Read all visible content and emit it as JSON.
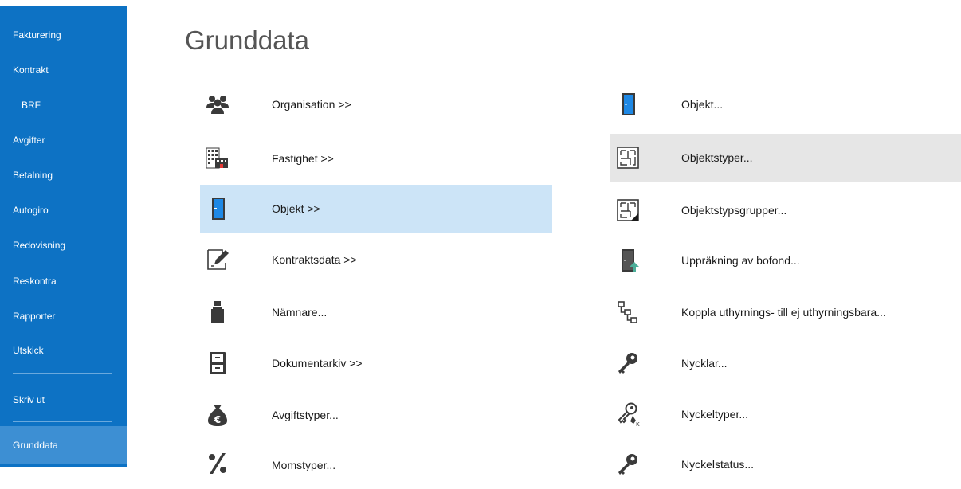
{
  "sidebar": {
    "items": [
      {
        "label": "Fakturering"
      },
      {
        "label": "Kontrakt"
      },
      {
        "label": "BRF"
      },
      {
        "label": "Avgifter"
      },
      {
        "label": "Betalning"
      },
      {
        "label": "Autogiro"
      },
      {
        "label": "Redovisning"
      },
      {
        "label": "Reskontra"
      },
      {
        "label": "Rapporter"
      },
      {
        "label": "Utskick"
      },
      {
        "label": "Skriv ut"
      },
      {
        "label": "Grunddata"
      }
    ],
    "active": "Grunddata"
  },
  "main": {
    "title": "Grunddata",
    "left_items": [
      {
        "label": "Organisation >>",
        "icon": "people-icon"
      },
      {
        "label": "Fastighet >>",
        "icon": "building-icon"
      },
      {
        "label": "Objekt >>",
        "icon": "door-icon",
        "selected": true
      },
      {
        "label": "Kontraktsdata >>",
        "icon": "contract-edit-icon"
      },
      {
        "label": "Nämnare...",
        "icon": "weight-icon"
      },
      {
        "label": "Dokumentarkiv >>",
        "icon": "file-cabinet-icon"
      },
      {
        "label": "Avgiftstyper...",
        "icon": "money-bag-euro-icon"
      },
      {
        "label": "Momstyper...",
        "icon": "percent-icon"
      }
    ],
    "right_items": [
      {
        "label": "Objekt...",
        "icon": "door-blue-icon"
      },
      {
        "label": "Objektstyper...",
        "icon": "floorplan-icon",
        "hovered": true
      },
      {
        "label": "Objektstypsgrupper...",
        "icon": "floorplan-group-icon"
      },
      {
        "label": "Uppräkning av bofond...",
        "icon": "door-up-arrow-icon"
      },
      {
        "label": "Koppla uthyrnings- till ej uthyrningsbara...",
        "icon": "hierarchy-icon"
      },
      {
        "label": "Nycklar...",
        "icon": "key-icon"
      },
      {
        "label": "Nyckeltyper...",
        "icon": "keys-icon"
      },
      {
        "label": "Nyckelstatus...",
        "icon": "key-status-icon"
      }
    ]
  },
  "colors": {
    "sidebar": "#0d72c4",
    "sidebar_active": "#3d8fd3",
    "selected": "#cce4f7",
    "hover": "#e6e6e6",
    "icon_blue": "#1e88e5",
    "icon_dark": "#3a3a3a"
  }
}
